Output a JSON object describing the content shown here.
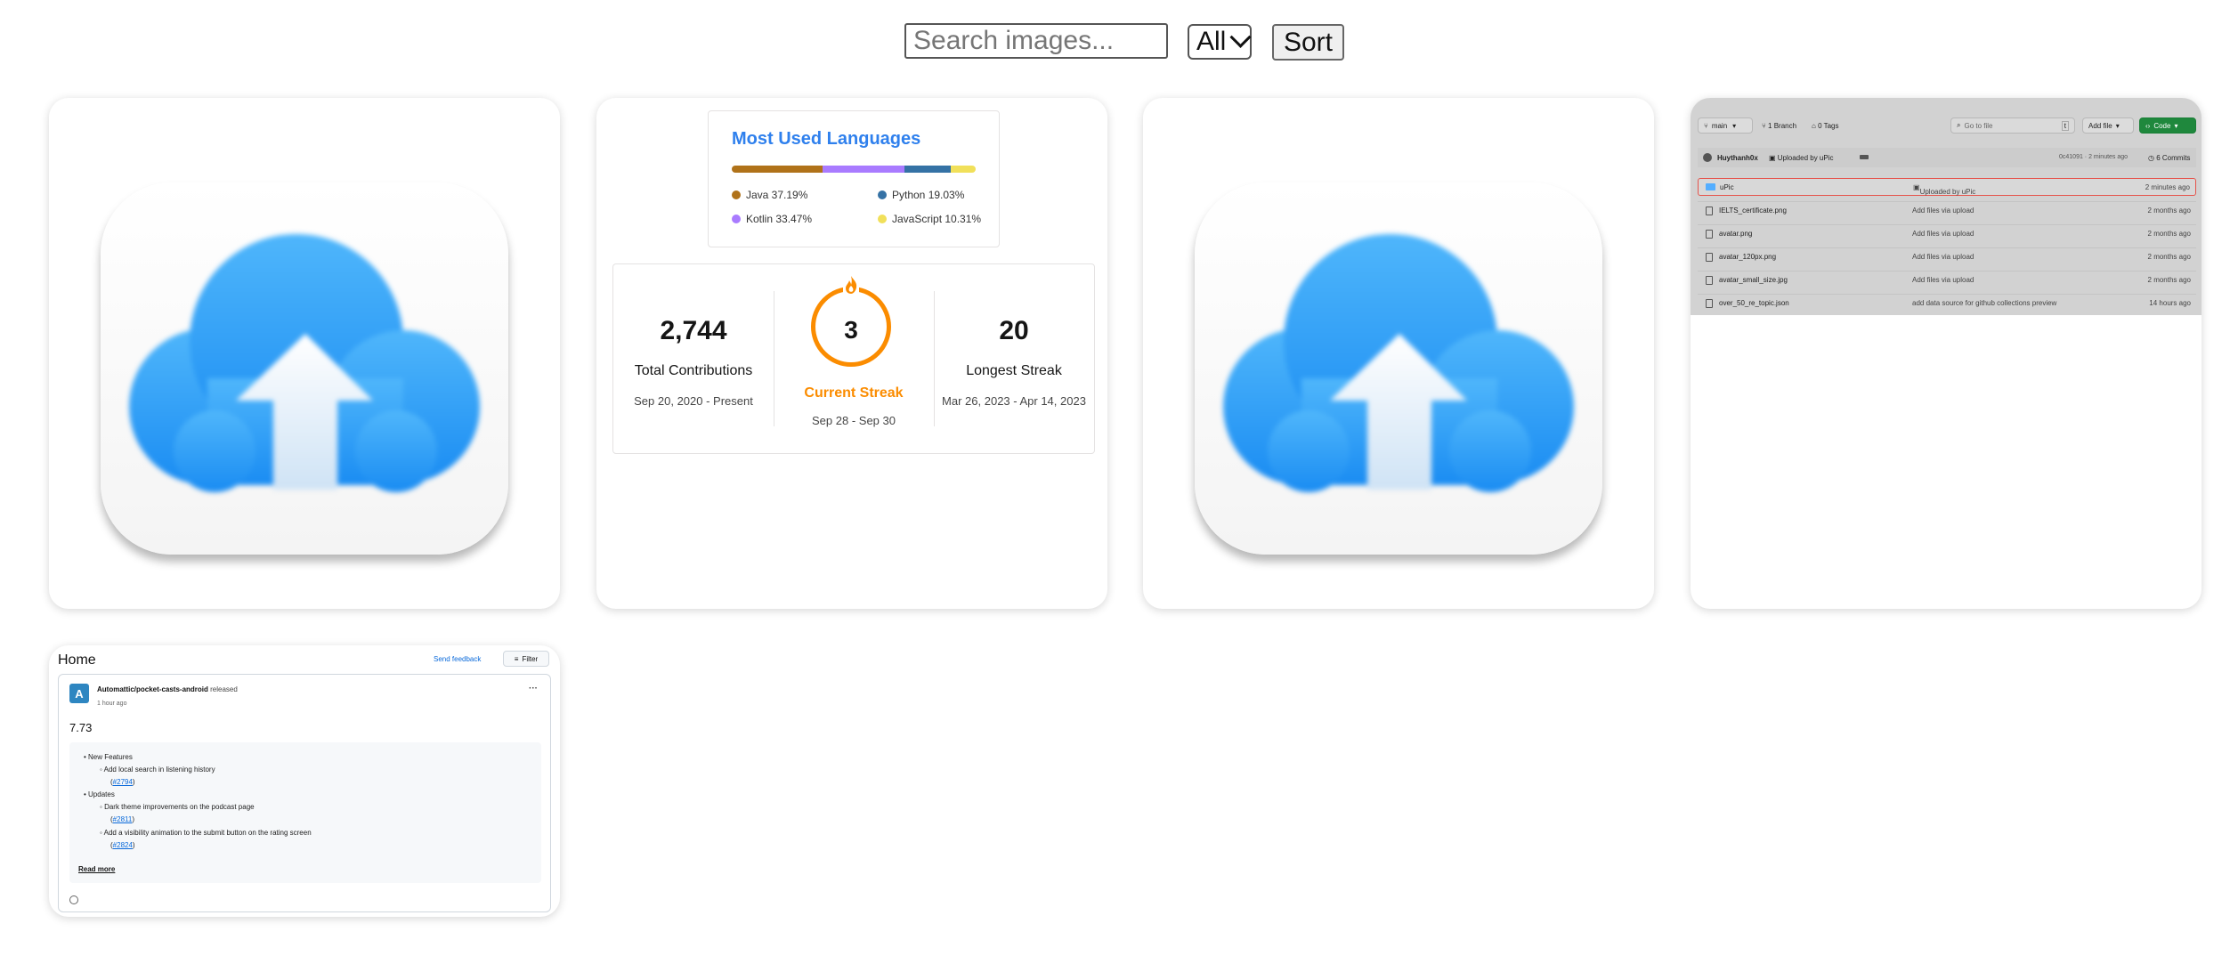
{
  "toolbar": {
    "search_placeholder": "Search images...",
    "search_value": "",
    "filter_selected": "All",
    "sort_label": "Sort"
  },
  "stats": {
    "languages_title": "Most Used Languages",
    "languages": [
      {
        "name": "Java 37.19%",
        "percent": 37.19,
        "color": "#b07219"
      },
      {
        "name": "Python 19.03%",
        "percent": 19.03,
        "color": "#3572a5"
      },
      {
        "name": "Kotlin 33.47%",
        "percent": 33.47,
        "color": "#a97bff"
      },
      {
        "name": "JavaScript 10.31%",
        "percent": 10.31,
        "color": "#f1e05a"
      }
    ],
    "total_contributions": "2,744",
    "total_label": "Total Contributions",
    "total_range": "Sep 20, 2020 - Present",
    "current_streak": "3",
    "current_label": "Current Streak",
    "current_range": "Sep 28 - Sep 30",
    "longest_streak": "20",
    "longest_label": "Longest Streak",
    "longest_range": "Mar 26, 2023 - Apr 14, 2023",
    "accent_color": "#fb8c00",
    "title_color": "#2f80ed"
  },
  "repo": {
    "branch": "main",
    "branch_count": "1 Branch",
    "tag_count": "0 Tags",
    "goto_placeholder": "Go to file",
    "goto_shortcut": "t",
    "add_file": "Add file",
    "code": "Code",
    "author": "Huythanh0x",
    "commit_msg": "Uploaded by uPic",
    "commit_meta": "0c41091 · 2 minutes ago",
    "commits": "6 Commits",
    "files": [
      {
        "name": "uPic",
        "msg": "Uploaded by uPic",
        "time": "2 minutes ago"
      },
      {
        "name": "IELTS_certificate.png",
        "msg": "Add files via upload",
        "time": "2 months ago"
      },
      {
        "name": "avatar.png",
        "msg": "Add files via upload",
        "time": "2 months ago"
      },
      {
        "name": "avatar_120px.png",
        "msg": "Add files via upload",
        "time": "2 months ago"
      },
      {
        "name": "avatar_small_size.jpg",
        "msg": "Add files via upload",
        "time": "2 months ago"
      },
      {
        "name": "over_50_re_topic.json",
        "msg": "add data source for github collections preview",
        "time": "14 hours ago"
      }
    ]
  },
  "release": {
    "title": "Home",
    "send_feedback": "Send feedback",
    "filter": "Filter",
    "repo": "Automattic/pocket-casts-android",
    "action": "released",
    "time": "1 hour ago",
    "version": "7.73",
    "notes": {
      "features_heading": "New Features",
      "feature_1": "Add local search in listening history",
      "feature_1_link": "#2794",
      "updates_heading": "Updates",
      "update_1": "Dark theme improvements on the podcast page",
      "update_1_link": "#2811",
      "update_2": "Add a visibility animation to the submit button on the rating screen",
      "update_2_link": "#2824"
    },
    "read_more": "Read more"
  }
}
